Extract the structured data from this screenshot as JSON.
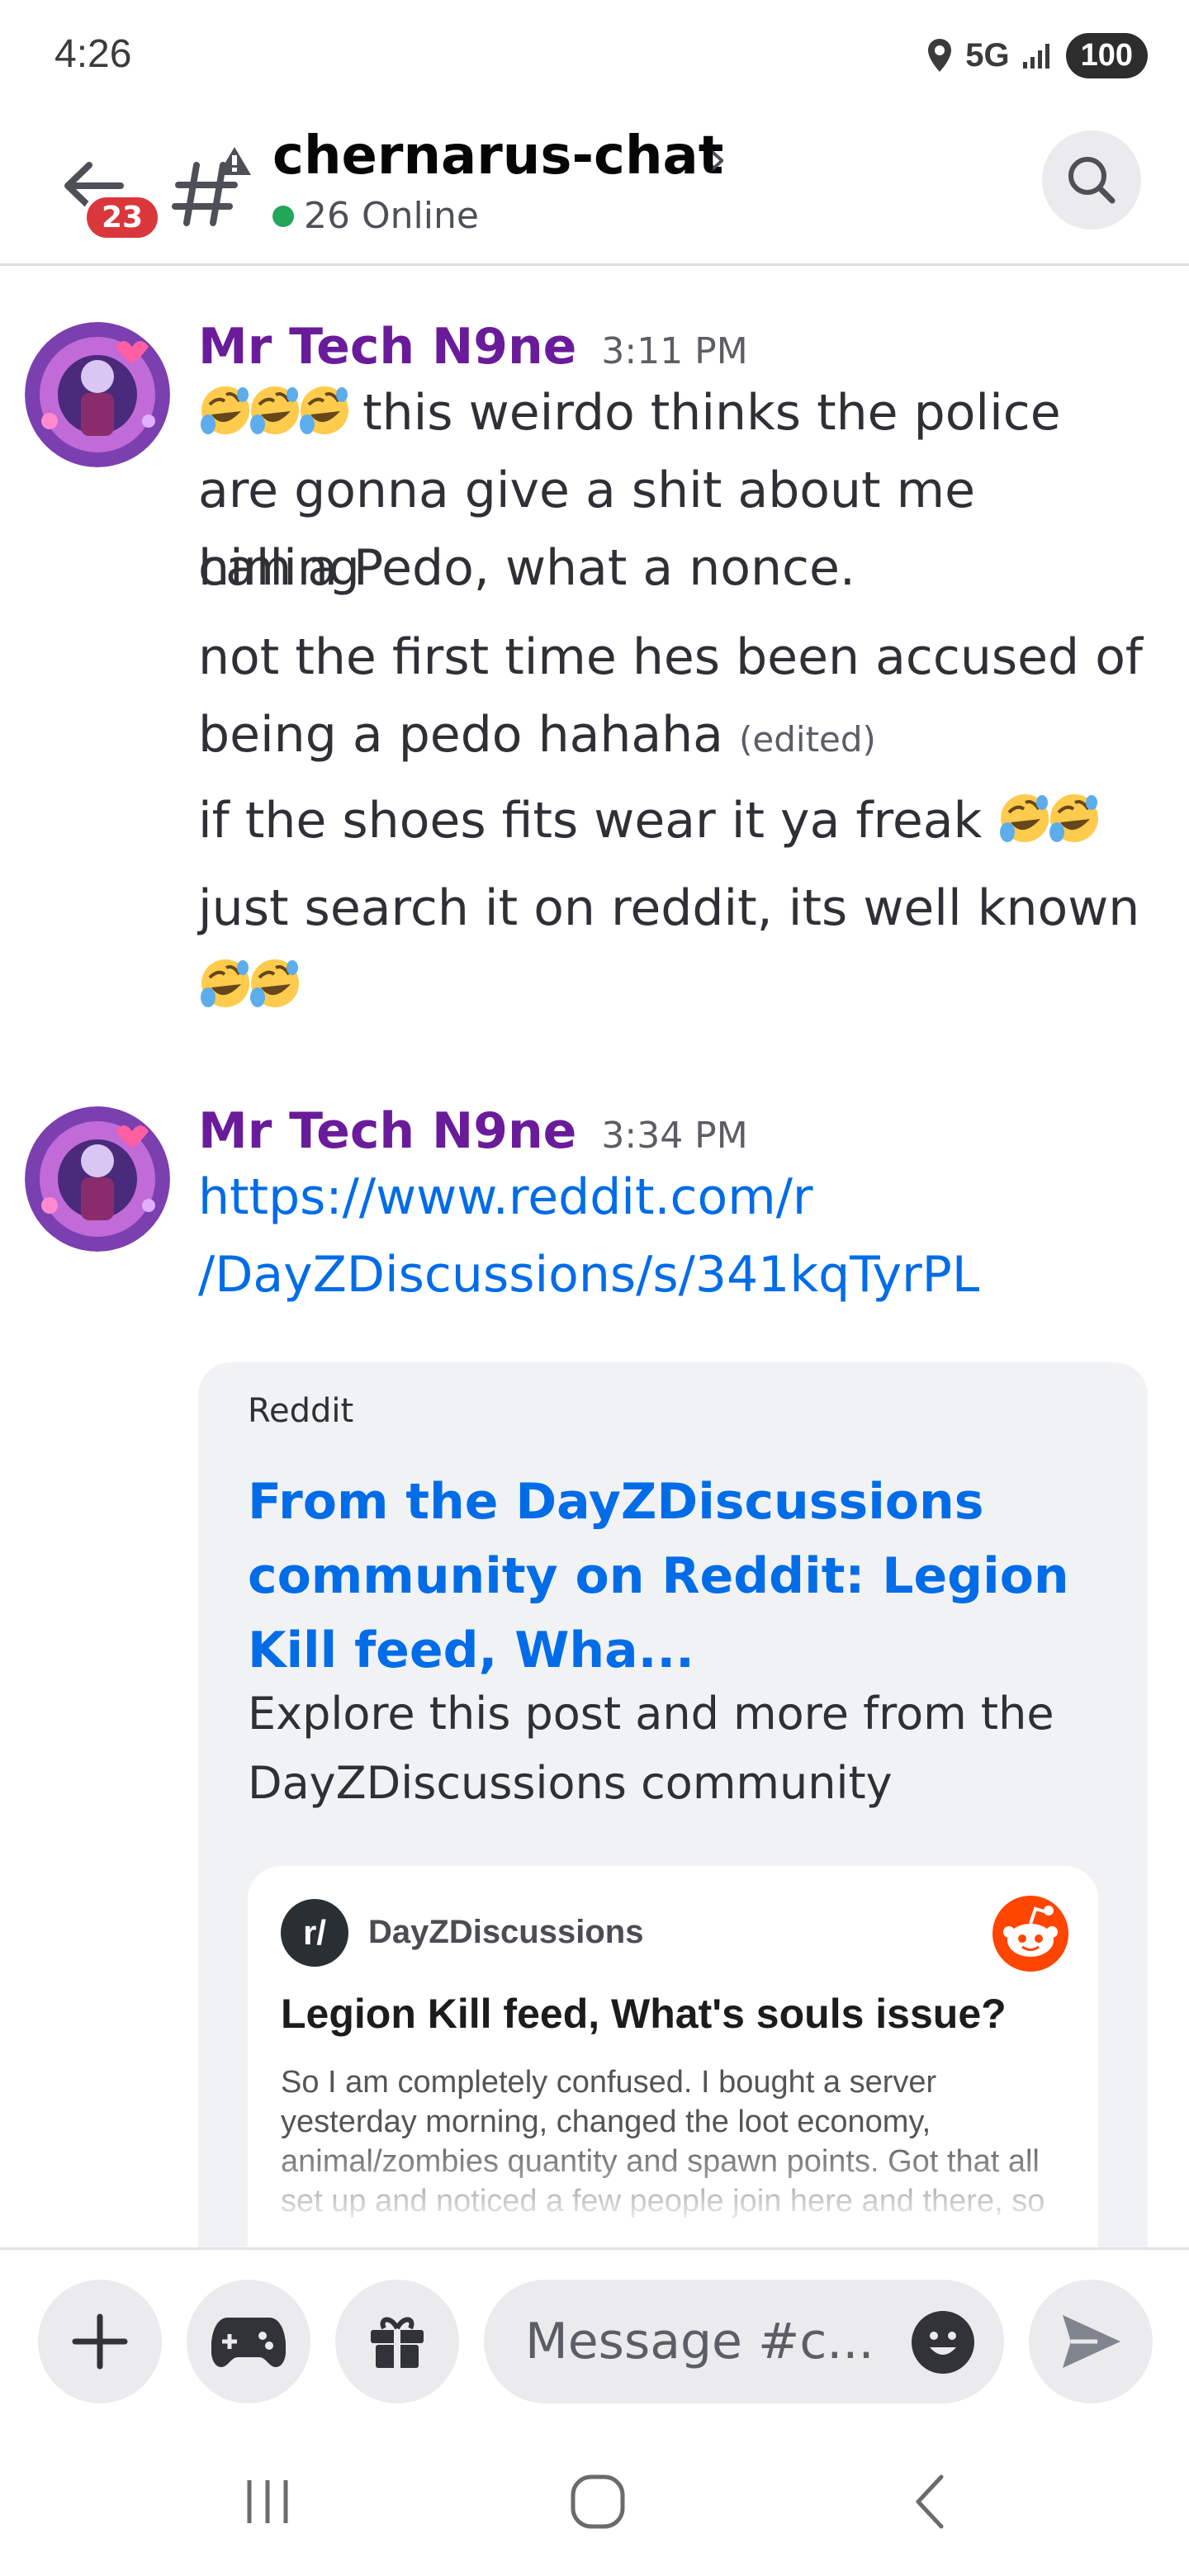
{
  "status_bar": {
    "time": "4:26",
    "network": "5G",
    "battery": "100"
  },
  "header": {
    "unread_count": "23",
    "channel_name": "chernarus-chat",
    "online": "26 Online"
  },
  "messages": [
    {
      "author": "Mr Tech N9ne",
      "timestamp": "3:11 PM",
      "lines": [
        "this weirdo thinks the police",
        "are gonna give a shit about me calling",
        "him a Pedo, what a nonce.",
        "not the first time hes been accused of",
        "being a pedo hahaha",
        "if the shoes fits wear it ya freak",
        "just search it on reddit, its well known"
      ],
      "edited_label": "(edited)"
    },
    {
      "author": "Mr Tech N9ne",
      "timestamp": "3:34 PM",
      "link_line1": "https://www.reddit.com/r",
      "link_line2": "/DayZDiscussions/s/341kqTyrPL"
    }
  ],
  "embed": {
    "provider": "Reddit",
    "title": "From the DayZDiscussions community on Reddit: Legion Kill feed, Wha...",
    "description": "Explore this post and more from the DayZDiscussions community",
    "card": {
      "sub_icon": "r/",
      "subreddit": "DayZDiscussions",
      "post_title": "Legion Kill feed, What's souls issue?",
      "post_body": "So I am completely confused. I bought a server yesterday morning, changed the loot economy, animal/zombies quantity and spawn points. Got that all set up and noticed a few people join here and there, so"
    }
  },
  "composer": {
    "placeholder": "Message #c..."
  },
  "icons": {
    "back": "back-arrow-icon",
    "channel": "text-channel-icon",
    "search": "search-icon",
    "plus": "plus-icon",
    "gamepad": "gamepad-icon",
    "gift": "gift-icon",
    "emoji": "emoji-icon",
    "send": "send-icon",
    "laughing": "rolling-on-floor-laughing-emoji"
  },
  "colors": {
    "author": "#6a1b9a",
    "link": "#006ce7",
    "online": "#23a55a",
    "badge": "#da373c"
  }
}
